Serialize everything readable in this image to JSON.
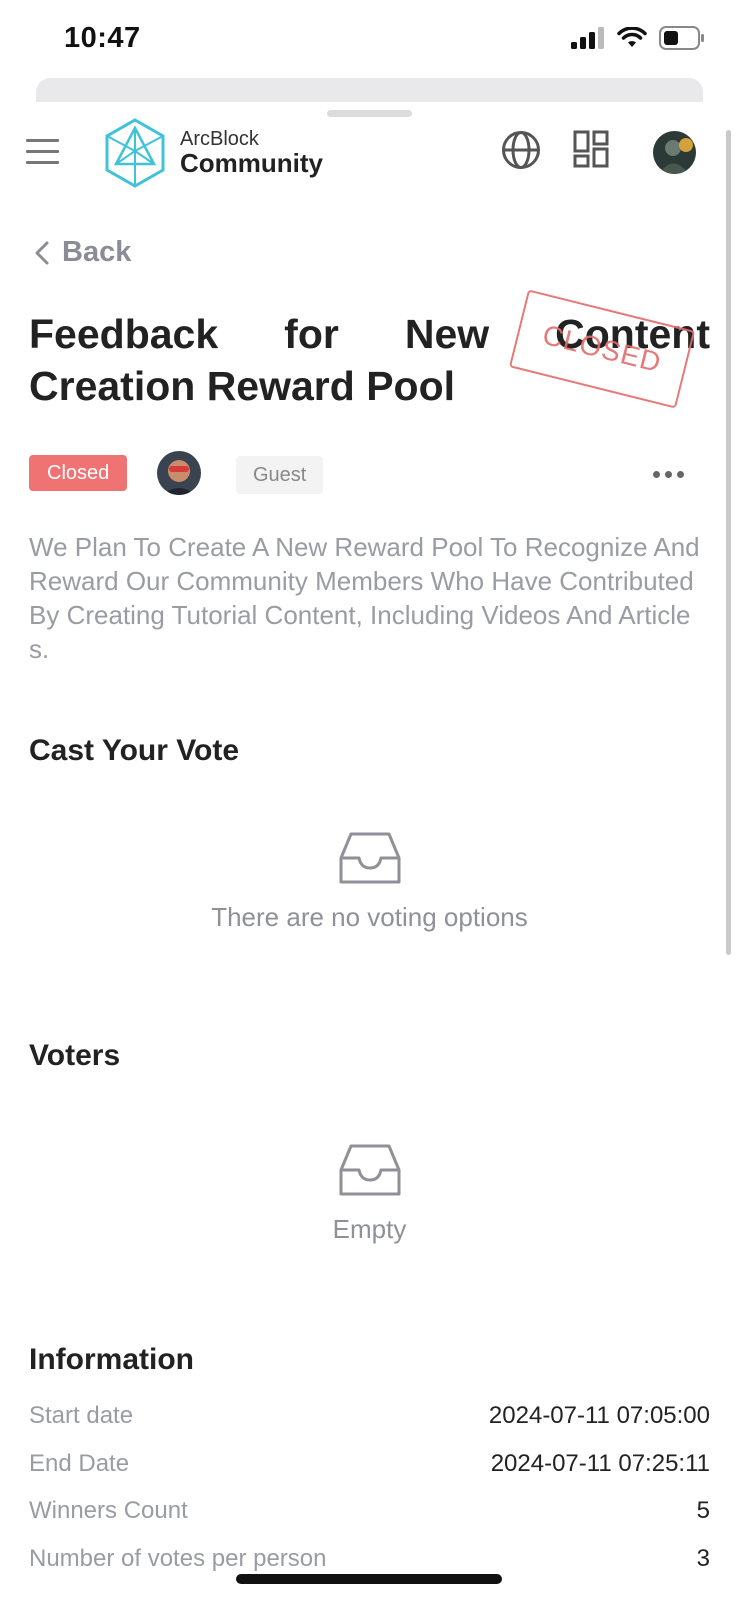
{
  "status_bar": {
    "time": "10:47",
    "icons": [
      "signal-icon",
      "wifi-icon",
      "battery-icon"
    ]
  },
  "header": {
    "logo_sub": "ArcBlock",
    "logo_main": "Community",
    "icons": [
      "menu-icon",
      "globe-icon",
      "apps-grid-icon",
      "user-avatar"
    ]
  },
  "nav": {
    "back_label": "Back"
  },
  "proposal": {
    "title": "Feedback for New Content Creation Reward Pool",
    "stamp": "CLOSED",
    "status_badge": "Closed",
    "role_tag": "Guest",
    "description": "We Plan To Create A New Reward Pool To Recognize And Reward Our Community Members Who Have Contributed By Creating Tutorial Content, Including Videos And Articles."
  },
  "vote_section": {
    "title": "Cast Your Vote",
    "empty_text": "There are no voting options"
  },
  "voters_section": {
    "title": "Voters",
    "empty_text": "Empty"
  },
  "information": {
    "title": "Information",
    "rows": [
      {
        "label": "Start date",
        "value": "2024-07-11 07:05:00"
      },
      {
        "label": "End Date",
        "value": "2024-07-11 07:25:11"
      },
      {
        "label": "Winners Count",
        "value": "5"
      },
      {
        "label": "Number of votes per person",
        "value": "3"
      }
    ]
  },
  "colors": {
    "accent_closed": "#f07373",
    "logo_cyan": "#3fc3d8",
    "muted_text": "#9a9ca3"
  }
}
